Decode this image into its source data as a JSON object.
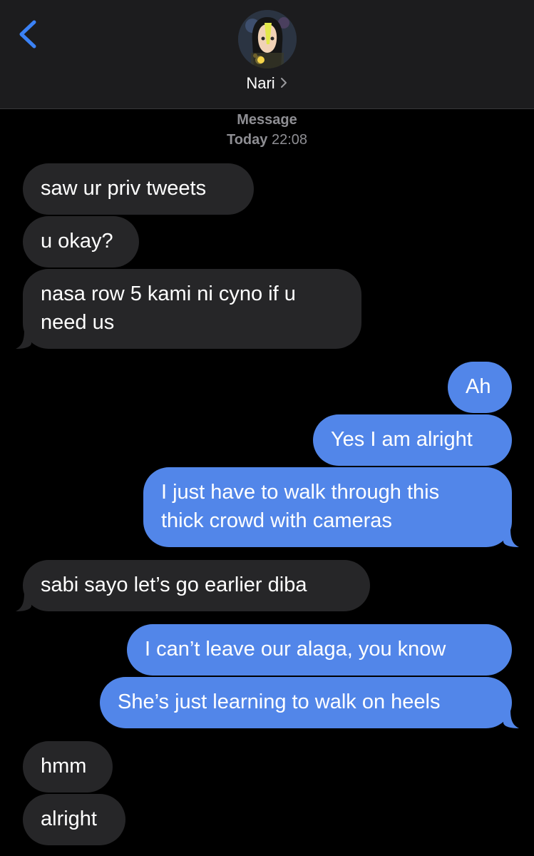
{
  "header": {
    "contact_name": "Nari",
    "service_label": "Message",
    "timestamp_day": "Today",
    "timestamp_time": "22:08"
  },
  "colors": {
    "header_bg": "#1c1c1e",
    "incoming_bubble": "#262628",
    "outgoing_bubble": "#5286e9",
    "back_chevron": "#3b82f6",
    "meta_text": "#8e8e93"
  },
  "icons": {
    "back": "chevron-left-icon",
    "name_chevron": "chevron-right-icon"
  },
  "messages": [
    {
      "direction": "incoming",
      "lines": [
        "saw ur priv tweets"
      ]
    },
    {
      "direction": "incoming",
      "lines": [
        "u okay?"
      ]
    },
    {
      "direction": "incoming",
      "lines": [
        "nasa row 5 kami ni cyno if u",
        "need us"
      ]
    },
    {
      "direction": "outgoing",
      "lines": [
        "Ah"
      ]
    },
    {
      "direction": "outgoing",
      "lines": [
        "Yes I am alright"
      ]
    },
    {
      "direction": "outgoing",
      "lines": [
        "I just have to walk through this",
        "thick crowd with cameras"
      ]
    },
    {
      "direction": "incoming",
      "lines": [
        "sabi sayo let’s go earlier diba"
      ]
    },
    {
      "direction": "outgoing",
      "lines": [
        "I can’t leave our alaga, you know"
      ]
    },
    {
      "direction": "outgoing",
      "lines": [
        "She’s just learning to walk on heels"
      ]
    },
    {
      "direction": "incoming",
      "lines": [
        "hmm"
      ]
    },
    {
      "direction": "incoming",
      "lines": [
        "alright"
      ]
    }
  ]
}
